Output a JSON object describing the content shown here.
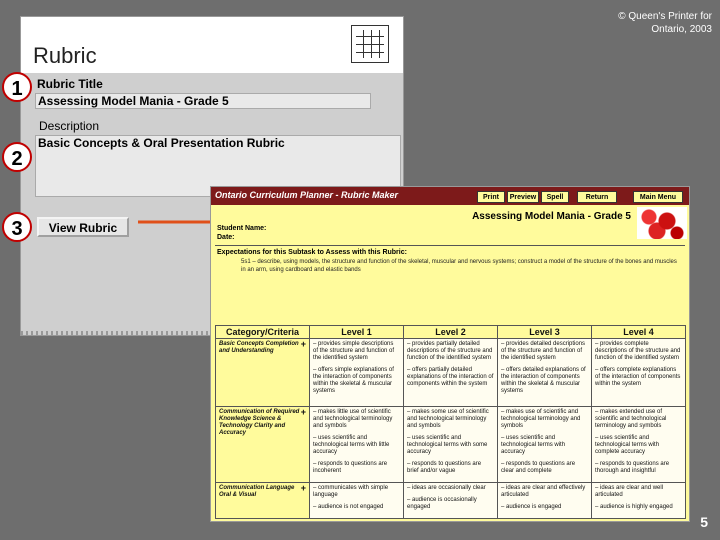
{
  "copyright": {
    "line1": "© Queen's Printer for",
    "line2": "Ontario, 2003"
  },
  "slide_number": "5",
  "badges": [
    "1",
    "2",
    "3"
  ],
  "panel": {
    "title": "Rubric",
    "rubric_title_label": "Rubric Title",
    "rubric_title_value": "Assessing Model Mania - Grade 5",
    "description_label": "Description",
    "description_value": "Basic Concepts & Oral Presentation Rubric",
    "view_button": "View Rubric"
  },
  "maker": {
    "title": "Ontario Curriculum Planner - Rubric Maker",
    "buttons": [
      "Print",
      "Preview",
      "Spell",
      "Return",
      "Main Menu"
    ],
    "subtitle": "Assessing Model Mania - Grade 5",
    "student_label": "Student Name:",
    "date_label": "Date:",
    "expectations_heading": "Expectations for this Subtask to Assess with this Rubric:",
    "expectations_text": "5s1 – describe, using models, the structure and function of the skeletal, muscular and nervous systems; construct a model of the structure of the bones and muscles in an arm, using cardboard and elastic bands",
    "headers": [
      "Category/Criteria",
      "Level 1",
      "Level 2",
      "Level 3",
      "Level 4"
    ],
    "rows": [
      {
        "category": "Basic Concepts Completion and Understanding",
        "cells": [
          [
            "– provides simple descriptions of the structure and function of the identified system",
            "– offers simple explanations of the interaction of components within the skeletal & muscular systems"
          ],
          [
            "– provides partially detailed descriptions of the structure and function of the identified system",
            "– offers partially detailed explanations of the interaction of components within the system"
          ],
          [
            "– provides detailed descriptions of the structure and function of the identified system",
            "– offers detailed explanations of the interaction of components within the skeletal & muscular systems"
          ],
          [
            "– provides complete descriptions of the structure and function of the identified system",
            "– offers complete explanations of the interaction of components within the system"
          ]
        ]
      },
      {
        "category": "Communication of Required Knowledge Science & Technology Clarity and Accuracy",
        "cells": [
          [
            "– makes little use of scientific and technological terminology and symbols",
            "– uses scientific and technological terms with little accuracy",
            "– responds to questions are incoherent"
          ],
          [
            "– makes some use of scientific and technological terminology and symbols",
            "– uses scientific and technological terms with some accuracy",
            "– responds to questions are brief and/or vague"
          ],
          [
            "– makes use of scientific and technological terminology and symbols",
            "– uses scientific and technological terms with accuracy",
            "– responds to questions are clear and complete"
          ],
          [
            "– makes extended use of scientific and technological terminology and symbols",
            "– uses scientific and technological terms with complete accuracy",
            "– responds to questions are thorough and insightful"
          ]
        ]
      },
      {
        "category": "Communication Language Oral & Visual",
        "cells": [
          [
            "– communicates with simple language",
            "– audience is not engaged"
          ],
          [
            "– ideas are occasionally clear",
            "– audience is occasionally engaged"
          ],
          [
            "– ideas are clear and effectively articulated",
            "– audience is engaged"
          ],
          [
            "– ideas are clear and well articulated",
            "– audience is highly engaged"
          ]
        ]
      }
    ]
  }
}
